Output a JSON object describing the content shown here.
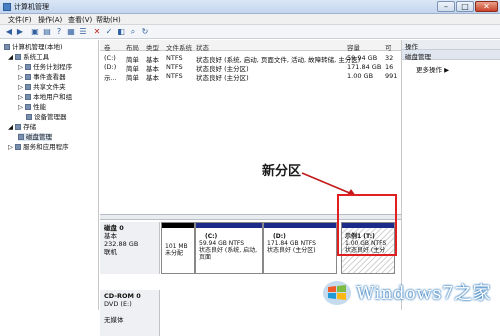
{
  "window": {
    "title": "计算机管理"
  },
  "menu": {
    "items": [
      "文件(F)",
      "操作(A)",
      "查看(V)",
      "帮助(H)"
    ]
  },
  "tree": {
    "root": "计算机管理(本地)",
    "system_tools": "系统工具",
    "task_scheduler": "任务计划程序",
    "event_viewer": "事件查看器",
    "shared_folders": "共享文件夹",
    "local_users": "本地用户和组",
    "performance": "性能",
    "device_manager": "设备管理器",
    "storage": "存储",
    "disk_management": "磁盘管理",
    "services": "服务和应用程序"
  },
  "volume_table": {
    "columns": [
      "卷",
      "布局",
      "类型",
      "文件系统",
      "状态",
      "容量",
      "可"
    ],
    "rows": [
      {
        "vol": "(C:)",
        "layout": "简单",
        "type": "基本",
        "fs": "NTFS",
        "status": "状态良好 (系统, 启动, 页面文件, 活动, 故障转储, 主分区)",
        "capacity": "59.94 GB",
        "free": "32"
      },
      {
        "vol": "(D:)",
        "layout": "简单",
        "type": "基本",
        "fs": "NTFS",
        "status": "状态良好 (主分区)",
        "capacity": "171.84 GB",
        "free": "16"
      },
      {
        "vol": "示...",
        "layout": "简单",
        "type": "基本",
        "fs": "NTFS",
        "status": "状态良好 (主分区)",
        "capacity": "1.00 GB",
        "free": "991"
      }
    ]
  },
  "disk0": {
    "name": "磁盘 0",
    "type": "基本",
    "size": "232.88 GB",
    "state": "联机",
    "partitions": [
      {
        "line1": "101 MB",
        "line2": "未分配"
      },
      {
        "line1": "(C:)",
        "line2": "59.94 GB NTFS",
        "line3": "状态良好 (系统, 启动, 页面",
        "kind": "primary"
      },
      {
        "line1": "(D:)",
        "line2": "171.84 GB NTFS",
        "line3": "状态良好 (主分区)",
        "kind": "primary"
      },
      {
        "line1": "示例1  (T:)",
        "line2": "1.00 GB NTFS",
        "line3": "状态良好 (主分",
        "kind": "new"
      }
    ]
  },
  "cdrom": {
    "name": "CD-ROM 0",
    "drive": "DVD (E:)",
    "media": "无媒体"
  },
  "actions": {
    "title": "操作",
    "section": "磁盘管理",
    "more": "更多操作"
  },
  "annotation": {
    "label": "新分区"
  },
  "watermark": {
    "text": "Windows7之家"
  },
  "colors": {
    "primary_bar": "#1c2a8a",
    "highlight": "#e02020",
    "accent": "#1d6fb8"
  }
}
